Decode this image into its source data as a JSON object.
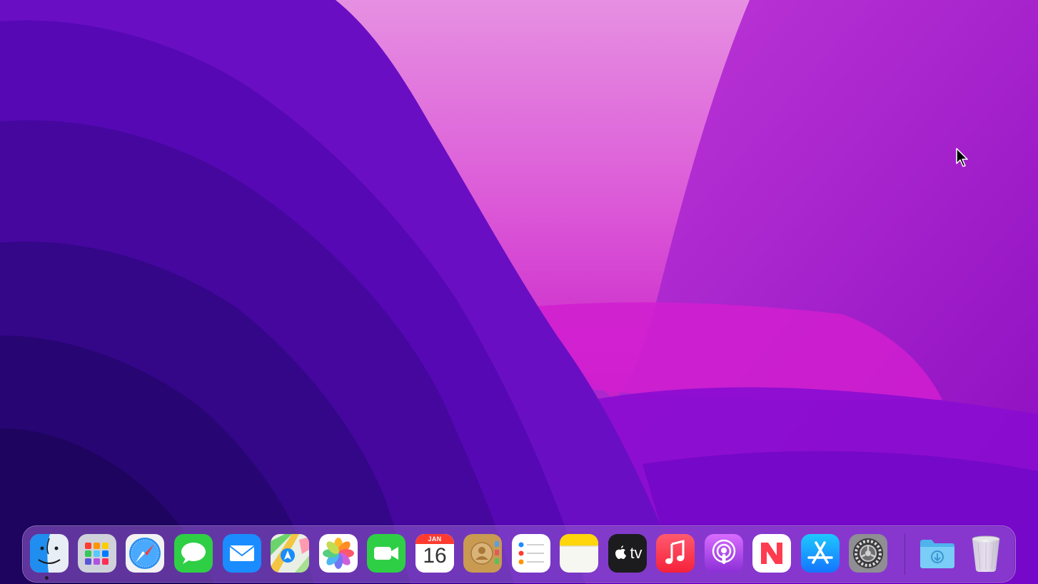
{
  "dock": {
    "items": [
      {
        "id": "finder",
        "icon": "finder-icon",
        "running": true
      },
      {
        "id": "launchpad",
        "icon": "launchpad-icon"
      },
      {
        "id": "safari",
        "icon": "safari-icon"
      },
      {
        "id": "messages",
        "icon": "messages-icon"
      },
      {
        "id": "mail",
        "icon": "mail-icon"
      },
      {
        "id": "maps",
        "icon": "maps-icon"
      },
      {
        "id": "photos",
        "icon": "photos-icon"
      },
      {
        "id": "facetime",
        "icon": "facetime-icon"
      },
      {
        "id": "calendar",
        "icon": "calendar-icon"
      },
      {
        "id": "contacts",
        "icon": "contacts-icon"
      },
      {
        "id": "reminders",
        "icon": "reminders-icon"
      },
      {
        "id": "notes",
        "icon": "notes-icon"
      },
      {
        "id": "tv",
        "icon": "apple-tv-icon"
      },
      {
        "id": "music",
        "icon": "music-icon"
      },
      {
        "id": "podcasts",
        "icon": "podcasts-icon"
      },
      {
        "id": "news",
        "icon": "news-icon"
      },
      {
        "id": "app-store",
        "icon": "app-store-icon"
      },
      {
        "id": "system-preferences",
        "icon": "system-preferences-icon"
      },
      {
        "id": "downloads",
        "icon": "downloads-folder-icon"
      },
      {
        "id": "trash",
        "icon": "trash-icon"
      }
    ],
    "calendar": {
      "month": "JAN",
      "day": "16"
    },
    "tv": {
      "label": "tv"
    }
  },
  "colors": {
    "wallpaper_dark": "#2a0a6e",
    "wallpaper_mid": "#6a10c8",
    "wallpaper_pink": "#d040d8",
    "wallpaper_light": "#e07ae0"
  }
}
